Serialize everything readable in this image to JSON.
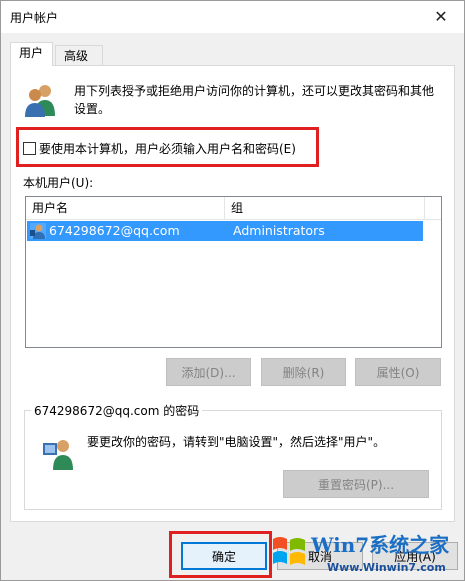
{
  "window": {
    "title": "用户帐户",
    "close_glyph": "✕"
  },
  "tabs": [
    {
      "label": "用户",
      "active": true
    },
    {
      "label": "高级",
      "active": false
    }
  ],
  "intro": {
    "text": "用下列表授予或拒绝用户访问你的计算机，还可以更改其密码和其他设置。"
  },
  "require_login": {
    "label": "要使用本计算机，用户必须输入用户名和密码(E)",
    "checked": false
  },
  "users_section": {
    "label": "本机用户(U):",
    "columns": [
      "用户名",
      "组"
    ],
    "rows": [
      {
        "name": "674298672@qq.com",
        "group": "Administrators",
        "selected": true
      }
    ]
  },
  "user_buttons": {
    "add": "添加(D)...",
    "delete": "删除(R)",
    "properties": "属性(O)"
  },
  "password_group": {
    "title": "674298672@qq.com 的密码",
    "text": "要更改你的密码，请转到\"电脑设置\"，然后选择\"用户\"。",
    "reset_button": "重置密码(P)..."
  },
  "dialog_buttons": {
    "ok": "确定",
    "cancel": "取消",
    "apply": "应用(A)"
  },
  "watermark": {
    "title": "Win7系统之家",
    "url": "Www.Winwin7.com"
  },
  "colors": {
    "selection": "#3399ff",
    "highlight": "#e02020",
    "accent": "#0078d7"
  },
  "icons": {
    "intro": "users-icon",
    "row": "user-icon",
    "password": "user-password-icon",
    "watermark": "windows-logo-icon"
  }
}
